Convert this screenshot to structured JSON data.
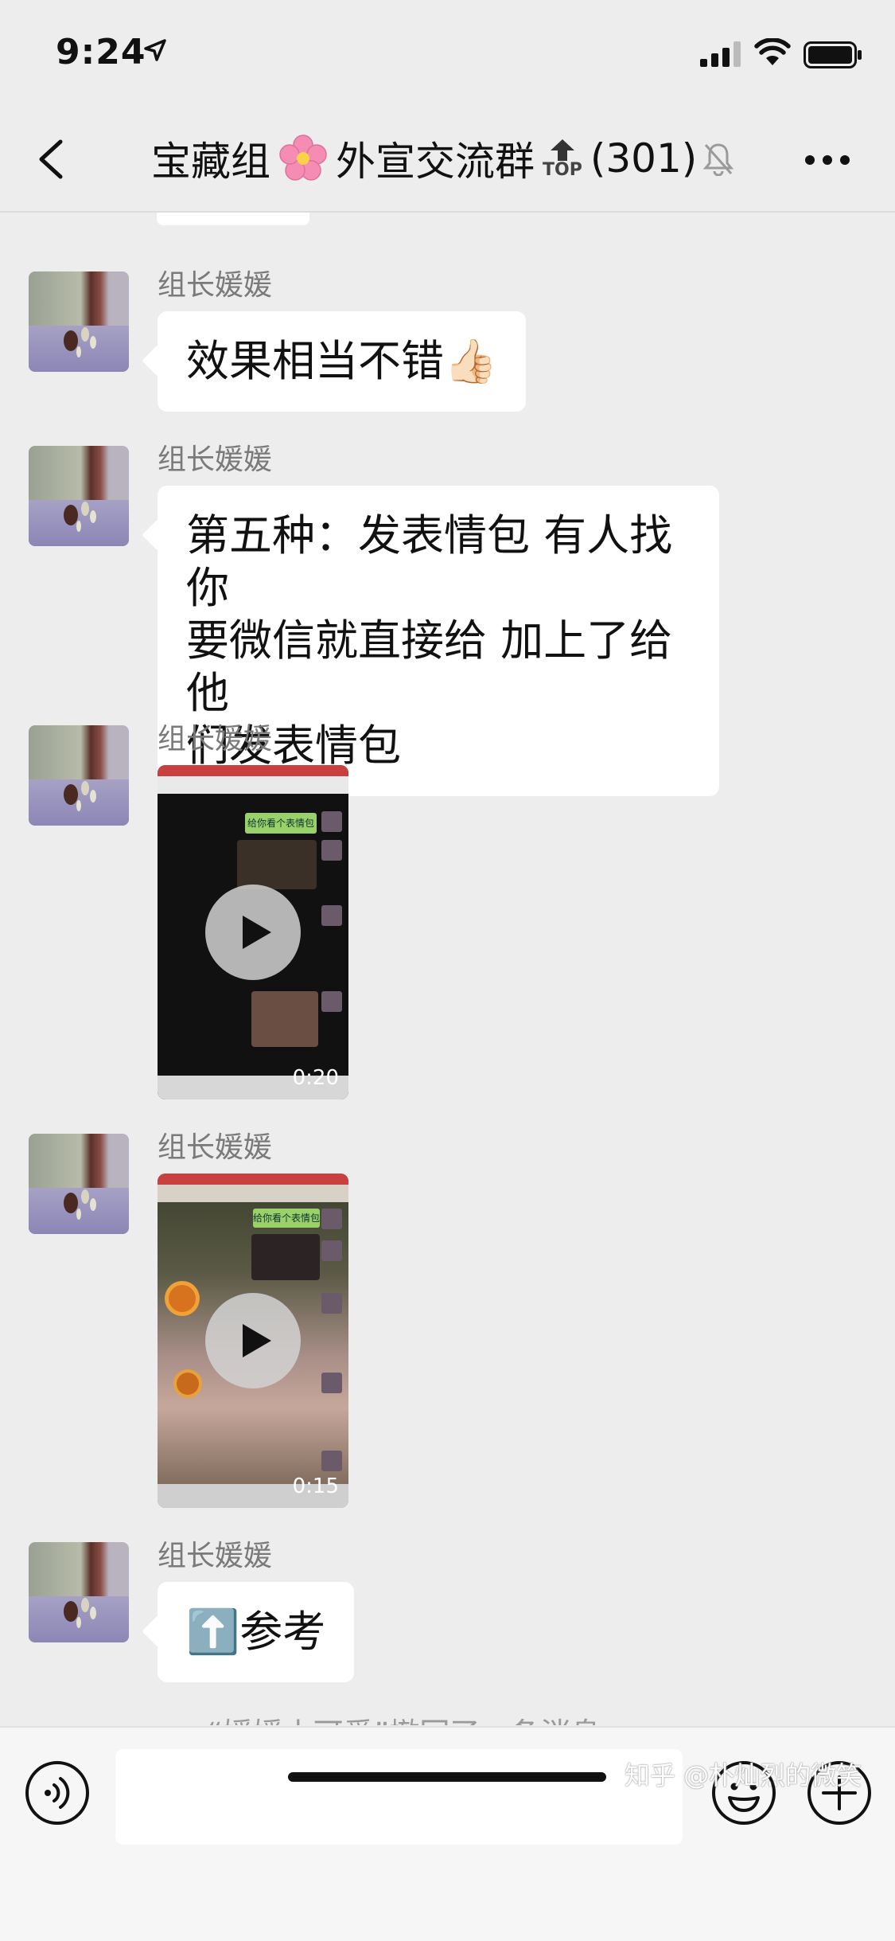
{
  "status": {
    "time": "9:24"
  },
  "header": {
    "title_part1": "宝藏组",
    "title_part2": "外宣交流群",
    "top_label": "TOP",
    "member_count": "(301)"
  },
  "messages": [
    {
      "sender": "组长媛媛",
      "type": "text",
      "lines": [
        "效果相当不错👍🏻"
      ]
    },
    {
      "sender": "组长媛媛",
      "type": "text",
      "lines": [
        "第五种：发表情包 有人找你",
        "要微信就直接给 加上了给他",
        "们发表情包"
      ]
    },
    {
      "sender": "组长媛媛",
      "type": "video",
      "duration": "0:20",
      "overlay_text": "给你看个表情包"
    },
    {
      "sender": "组长媛媛",
      "type": "video",
      "duration": "0:15",
      "overlay_text": "给你看个表情包"
    },
    {
      "sender": "组长媛媛",
      "type": "text",
      "lines": [
        "⬆️参考"
      ]
    }
  ],
  "system_notice": "“媛媛小可爱”撤回了一条消息",
  "watermark": "知乎 @朴灿烈的微笑",
  "colors": {
    "background": "#ededed",
    "bubble": "#ffffff",
    "sender": "#7a7a7a"
  }
}
